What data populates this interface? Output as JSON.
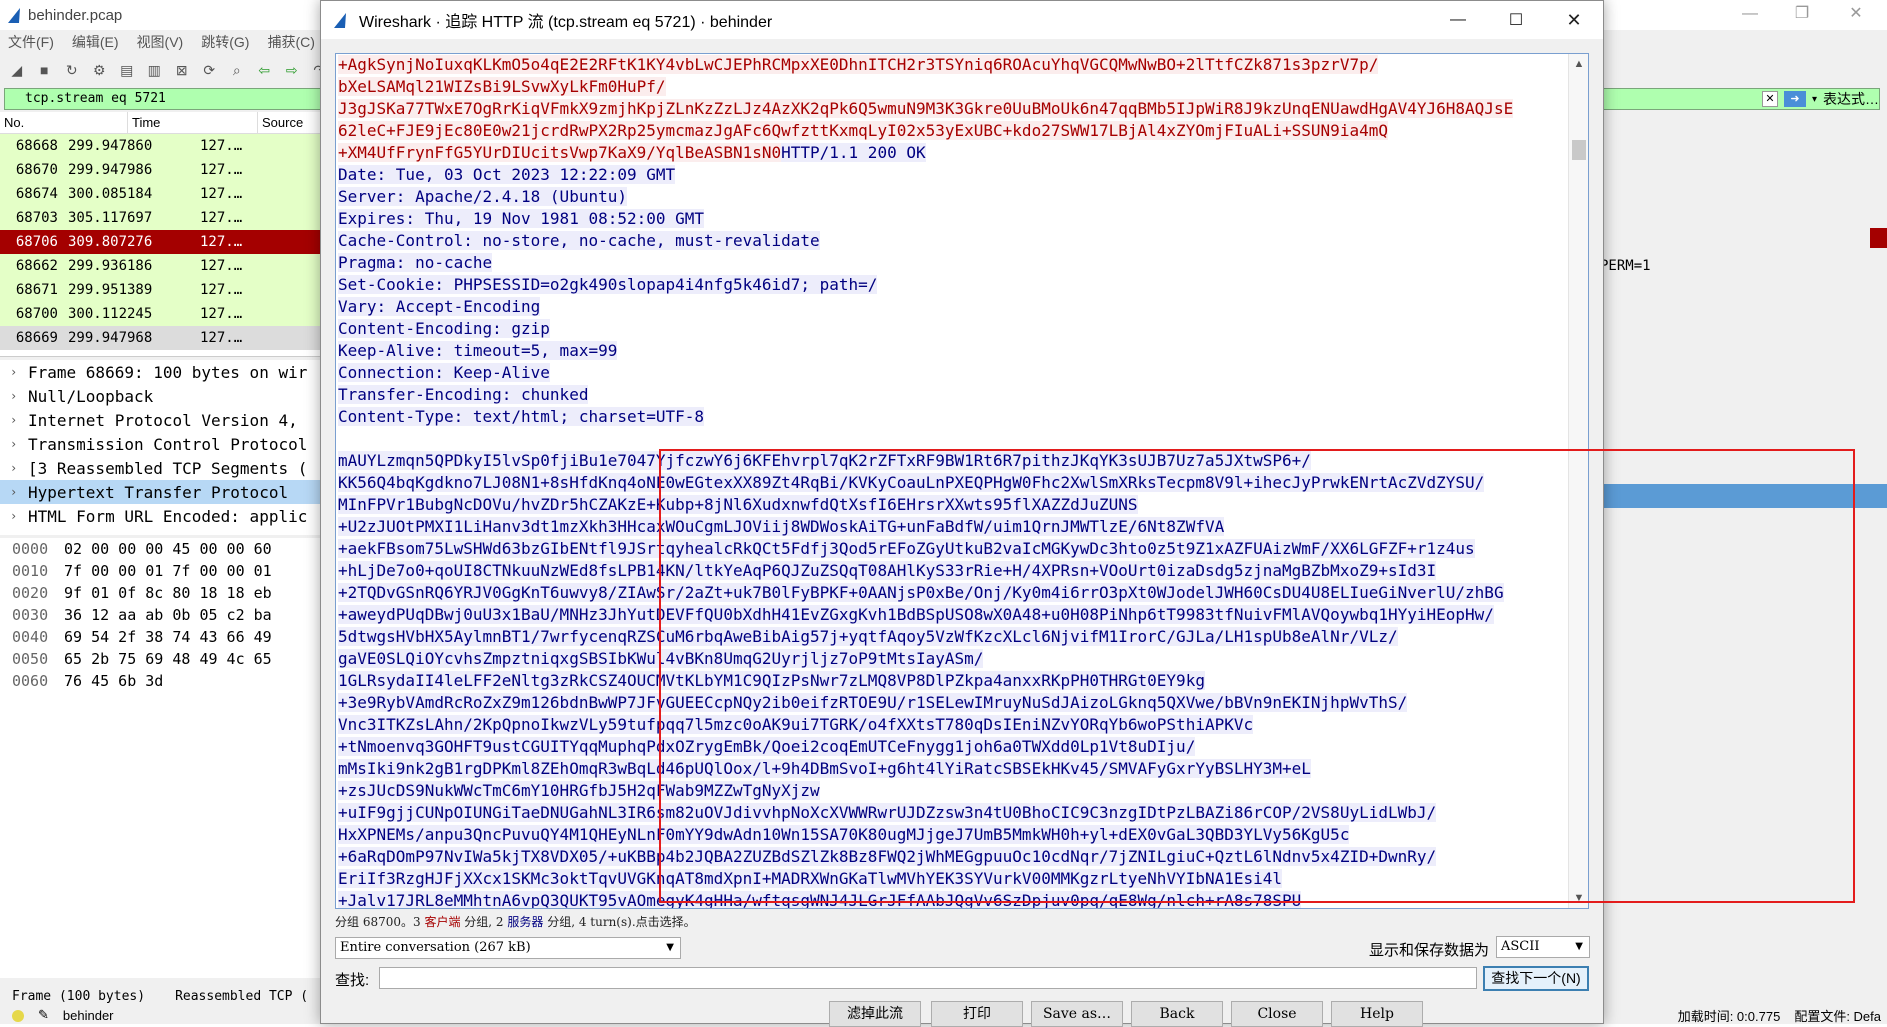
{
  "background": {
    "title": "behinder.pcap",
    "menus": [
      "文件(F)",
      "编辑(E)",
      "视图(V)",
      "跳转(G)",
      "捕获(C)"
    ],
    "filter": "tcp.stream eq 5721",
    "filter_right_label": "表达式…",
    "list_headers": [
      "No.",
      "Time",
      "Source"
    ],
    "packets": [
      {
        "no": "68668",
        "time": "299.947860",
        "src": "127.…"
      },
      {
        "no": "68670",
        "time": "299.947986",
        "src": "127.…"
      },
      {
        "no": "68674",
        "time": "300.085184",
        "src": "127.…"
      },
      {
        "no": "68703",
        "time": "305.117697",
        "src": "127.…"
      },
      {
        "no": "68706",
        "time": "309.807276",
        "src": "127.…"
      },
      {
        "no": "68662",
        "time": "299.936186",
        "src": "127.…"
      },
      {
        "no": "68671",
        "time": "299.951389",
        "src": "127.…"
      },
      {
        "no": "68700",
        "time": "300.112245",
        "src": "127.…"
      },
      {
        "no": "68669",
        "time": "299.947968",
        "src": "127.…"
      }
    ],
    "right_text": "PERM=1",
    "details": [
      "Frame 68669: 100 bytes on wir",
      "Null/Loopback",
      "Internet Protocol Version 4,",
      "Transmission Control Protocol",
      "[3 Reassembled TCP Segments (",
      "Hypertext Transfer Protocol",
      "HTML Form URL Encoded: applic"
    ],
    "hex": [
      {
        "off": "0000",
        "bytes": "02 00 00 00 45 00 00 60"
      },
      {
        "off": "0010",
        "bytes": "7f 00 00 01 7f 00 00 01"
      },
      {
        "off": "0020",
        "bytes": "9f 01 0f 8c 80 18 18 eb"
      },
      {
        "off": "0030",
        "bytes": "36 12 aa ab 0b 05 c2 ba"
      },
      {
        "off": "0040",
        "bytes": "69 54 2f 38 74 43 66 49"
      },
      {
        "off": "0050",
        "bytes": "65 2b 75 69 48 49 4c 65"
      },
      {
        "off": "0060",
        "bytes": "76 45 6b 3d"
      }
    ],
    "status_tabs": [
      "Frame (100 bytes)",
      "Reassembled TCP ("
    ],
    "status_file": "behinder",
    "status_right": [
      "加载时间: 0:0.775",
      "配置文件: Defa"
    ]
  },
  "dialog": {
    "title": "Wireshark · 追踪 HTTP 流 (tcp.stream eq 5721) · behinder",
    "stream": [
      {
        "t": "cli",
        "s": "+AgkSynjNoIuxqKLKmO5o4qE2E2RFtK1KY4vbLwCJEPhRCMpxXE0DhnITCH2r3TSYniq6ROAcuYhqVGCQMwNwBO+2lTtfCZk871s3pzrV7p/"
      },
      {
        "t": "cli",
        "s": "bXeLSAMql21WIZsBi9LSvwXyLkFm0HuPf/"
      },
      {
        "t": "cli",
        "s": "J3gJSKa77TWxE7OgRrKiqVFmkX9zmjhKpjZLnKzZzLJz4AzXK2qPk6Q5wmuN9M3K3Gkre0UuBMoUk6n47qqBMb5IJpWiR8J9kzUnqENUawdHgAV4YJ6H8AQJsE"
      },
      {
        "t": "cli",
        "s": "62leC+FJE9jEc80E0w21jcrdRwPX2Rp25ymcmazJgAFc6QwfzttKxmqLyI02x53yExUBC+kdo27SWW17LBjAl4xZYOmjFIuALi+SSUN9ia4mQ"
      },
      {
        "t": "mix",
        "c": "+XM4UfFrynFfG5YUrDIUcitsVwp7KaX9/YqlBeASBN1sN0",
        "s": "HTTP/1.1 200 OK"
      },
      {
        "t": "srv",
        "s": "Date: Tue, 03 Oct 2023 12:22:09 GMT"
      },
      {
        "t": "srv",
        "s": "Server: Apache/2.4.18 (Ubuntu)"
      },
      {
        "t": "srv",
        "s": "Expires: Thu, 19 Nov 1981 08:52:00 GMT"
      },
      {
        "t": "srv",
        "s": "Cache-Control: no-store, no-cache, must-revalidate"
      },
      {
        "t": "srv",
        "s": "Pragma: no-cache"
      },
      {
        "t": "srv",
        "s": "Set-Cookie: PHPSESSID=o2gk490slopap4i4nfg5k46id7; path=/"
      },
      {
        "t": "srv",
        "s": "Vary: Accept-Encoding"
      },
      {
        "t": "srv",
        "s": "Content-Encoding: gzip"
      },
      {
        "t": "srv",
        "s": "Keep-Alive: timeout=5, max=99"
      },
      {
        "t": "srv",
        "s": "Connection: Keep-Alive"
      },
      {
        "t": "srv",
        "s": "Transfer-Encoding: chunked"
      },
      {
        "t": "srv",
        "s": "Content-Type: text/html; charset=UTF-8"
      },
      {
        "t": "blank",
        "s": ""
      },
      {
        "t": "srv",
        "s": "mAUYLzmqn5QPDkyI5lvSp0fjiBu1e7047YjfczwY6j6KFEhvrpl7qK2rZFTxRF9BW1Rt6R7pithzJKqYK3sUJB7Uz7a5JXtwSP6+/"
      },
      {
        "t": "srv",
        "s": "KK56Q4bqKgdkno7LJ08N1+8sHfdKnq4oNE0wEGtexXX89Zt4RqBi/KVKyCoauLnPXEQPHgW0Fhc2XwlSmXRksTecpm8V9l+ihecJyPrwkENrtAcZVdZYSU/"
      },
      {
        "t": "srv",
        "s": "MInFPVr1BubgNcDOVu/hvZDr5hCZAKzE+Kubp+8jNl6XudxnwfdQtXsfI6EHrsrXXwts95flXAZZdJuZUNS"
      },
      {
        "t": "srv",
        "s": "+U2zJUOtPMXI1LiHanv3dt1mzXkh3HHcaxWOuCgmLJOViij8WDWoskAiTG+unFaBdfW/uim1QrnJMWTlzE/6Nt8ZWfVA"
      },
      {
        "t": "srv",
        "s": "+aekFBsom75LwSHWd63bzGIbENtfl9JSrtqyhealcRkQCt5Fdfj3Qod5rEFoZGyUtkuB2vaIcMGKywDc3hto0z5t9Z1xAZFUAizWmF/XX6LGFZF+r1z4us"
      },
      {
        "t": "srv",
        "s": "+hLjDe7o0+qoUI8CTNkuuNzWEd8fsLPB14KN/ltkYeAqP6QJZuZSQqT08AHlKyS33rRie+H/4XPRsn+VOoUrt0izaDsdg5zjnaMgBZbMxoZ9+sId3I"
      },
      {
        "t": "srv",
        "s": "+2TQDvGSnRQ6YRJV0GgKnT6uwvy8/ZIAwSr/2aZt+uk7B0lFyBPKF+0AANjsP0xBe/Onj/Ky0m4i6rrO3pXt0WJodelJWH60CsDU4U8ELIueGiNverlU/zhBG"
      },
      {
        "t": "srv",
        "s": "+aweydPUqDBwj0uU3x1BaU/MNHz3JhYutDEVFfQU0bXdhH41EvZGxgKvh1BdBSpUSO8wX0A48+u0H08PiNhp6tT9983tfNuivFMlAVQoywbq1HYyiHEopHw/"
      },
      {
        "t": "srv",
        "s": "5dtwgsHVbHX5AylmnBT1/7wrfycenqRZSCuM6rbqAweBibAig57j+yqtfAqoy5VzWfKzcXLcl6NjvifM1IrorC/GJLa/LH1spUb8eAlNr/VLz/"
      },
      {
        "t": "srv",
        "s": "gaVE0SLQiOYcvhsZmpztniqxgSBSIbKWul4vBKn8UmqG2Uyrjljz7oP9tMtsIayASm/"
      },
      {
        "t": "srv",
        "s": "1GLRsydaII4leLFF2eNltg3zRkCSZ4OUCMVtKLbYM1C9QIzPsNwr7zLMQ8VP8DlPZkpa4anxxRKpPH0THRGt0EY9kg"
      },
      {
        "t": "srv",
        "s": "+3e9RybVAmdRcRoZxZ9m126bdnBwWP7JFvGUEECcpNQy2ib0eifzRTOE9U/r1SELewIMruyNuSdJAizoLGknq5QXVwe/bBVn9nEKINjhpWvThS/"
      },
      {
        "t": "srv",
        "s": "Vnc3ITKZsLAhn/2KpQpnoIkwzVLy59tufpqq7l5mzc0oAK9ui7TGRK/o4fXXtsT780qDsIEniNZvYORqYb6woPSthiAPKVc"
      },
      {
        "t": "srv",
        "s": "+tNmoenvq3GOHFT9ustCGUITYqqMuphqPdxOZrygEmBk/Qoei2coqEmUTCeFnygg1joh6a0TWXdd0Lp1Vt8uDIju/"
      },
      {
        "t": "srv",
        "s": "mMsIki9nk2gB1rgDPKml8ZEhOmqR3wBqLd46pUQlOox/l+9h4DBmSvoI+g6ht4lYiRatcSBSEkHKv45/SMVAFyGxrYyBSLHY3M+eL"
      },
      {
        "t": "srv",
        "s": "+zsJUcDS9NukWWcTmC6mY10HRGfbJ5H2qFWab9MZZwTgNyXjzw"
      },
      {
        "t": "srv",
        "s": "+uIF9gjjCUNpOIUNGiTaeDNUGahNL3IR6sm82uOVJdivvhpNoXcXVWWRwrUJDZzsw3n4tU0BhoCIC9C3nzgIDtPzLBAZi86rCOP/2VS8UyLidLWbJ/"
      },
      {
        "t": "srv",
        "s": "HxXPNEMs/anpu3QncPuvuQY4M1QHEyNLnF0mYY9dwAdn10Wn15SA70K80ugMJjgeJ7UmB5MmkWH0h+yl+dEX0vGaL3QBD3YLVy56KgU5c"
      },
      {
        "t": "srv",
        "s": "+6aRqDOmP97NvIWa5kjTX8VDX05/+uKBBp4b2JQBA2ZUZBdSZlZk8Bz8FWQ2jWhMEGgpuuOc10cdNqr/7jZNILgiuC+QztL6lNdnv5x4ZID+DwnRy/"
      },
      {
        "t": "srv",
        "s": "EriIf3RzgHJFjXXcx1SKMc3oktTqvUVGKnqAT8mdXpnI+MADRXWnGKaTlwMVhYEK3SYVurkV00MMKgzrLtyeNhVYIbNA1Esi4l"
      },
      {
        "t": "srv",
        "s": "+Jalv17JRL8eMMhtnA6vpQ3QUKT95vAOmegyK4gHHa/wftqsgWNJ4JLGrJFfAAbJQgVv6SzDpjuv0pq/qE8Wg/nlch+rA8s78SPU"
      }
    ],
    "summary": {
      "prefix": "分组 68700。3 ",
      "client": "客户端",
      "mid": " 分组, 2 ",
      "server": "服务器",
      "suffix": " 分组, 4 turn(s).点击选择。"
    },
    "conversation": "Entire conversation (267 kB)",
    "show_as_label": "显示和保存数据为",
    "show_as": "ASCII",
    "find_label": "查找:",
    "find_value": "",
    "find_next": "查找下一个(N)",
    "buttons": [
      "滤掉此流",
      "打印",
      "Save as…",
      "Back",
      "Close",
      "Help"
    ],
    "colors": {
      "client_fg": "#a60000",
      "client_bg": "#fbeded",
      "server_fg": "#000080",
      "server_bg": "#ededfb",
      "selected_packet": "#a40000",
      "filter_bg": "#afffaf"
    }
  }
}
